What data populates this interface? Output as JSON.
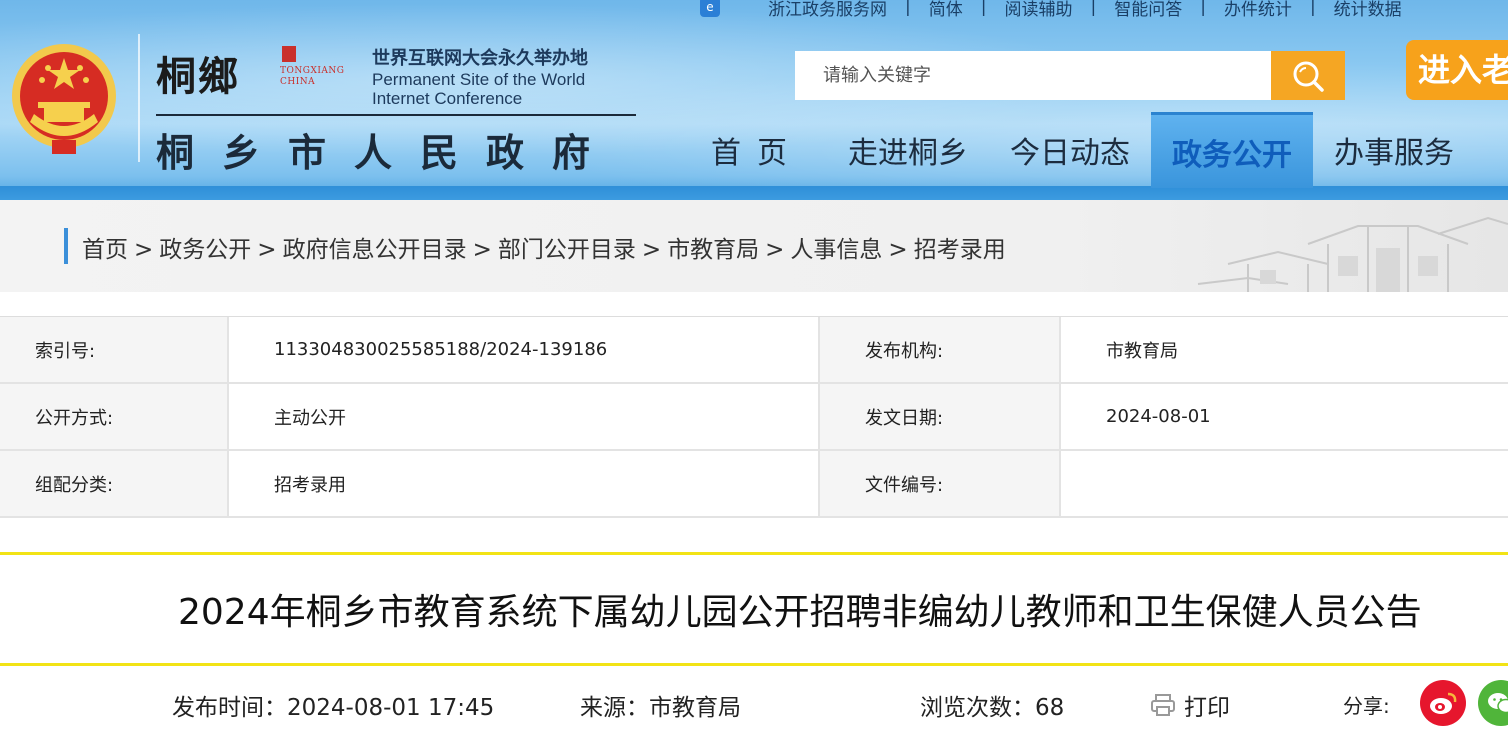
{
  "topbar": {
    "items": [
      "浙江政务服务网",
      "简体",
      "阅读辅助",
      "智能问答",
      "办件统计",
      "统计数据"
    ]
  },
  "logo": {
    "calligraphy": "桐鄉",
    "seal_sub1": "TONGXIANG",
    "seal_sub2": "CHINA",
    "slogan_cn": "世界互联网大会永久举办地",
    "slogan_en1": "Permanent Site of the World",
    "slogan_en2": "Internet Conference",
    "gov_name": "桐乡市人民政府"
  },
  "search": {
    "placeholder": "请输入关键字"
  },
  "enter_button": "进入老",
  "nav": {
    "items": [
      "首页",
      "走进桐乡",
      "今日动态",
      "政务公开",
      "办事服务"
    ],
    "active": "政务公开"
  },
  "breadcrumb": [
    "首页",
    "政务公开",
    "政府信息公开目录",
    "部门公开目录",
    "市教育局",
    "人事信息",
    "招考录用"
  ],
  "info": {
    "index_label": "索引号:",
    "index_value": "11330483002558518 8/2024-139186",
    "index_value_exact": "113304830025585188/2024-139186",
    "publisher_label": "发布机构:",
    "publisher_value": "市教育局",
    "method_label": "公开方式:",
    "method_value": "主动公开",
    "date_label": "发文日期:",
    "date_value": "2024-08-01",
    "category_label": "组配分类:",
    "category_value": "招考录用",
    "docno_label": "文件编号:",
    "docno_value": ""
  },
  "article": {
    "title": "2024年桐乡市教育系统下属幼儿园公开招聘非编幼儿教师和卫生保健人员公告",
    "publish_time": "发布时间：2024-08-01  17:45",
    "source": "来源：市教育局",
    "views": "浏览次数：68",
    "print_label": "打印",
    "share_label": "分享:"
  },
  "colors": {
    "accent_blue": "#3b8fd9",
    "search_button": "#f5a623",
    "title_border": "#f2e316",
    "weibo": "#e6162d",
    "wechat": "#50b53a"
  }
}
